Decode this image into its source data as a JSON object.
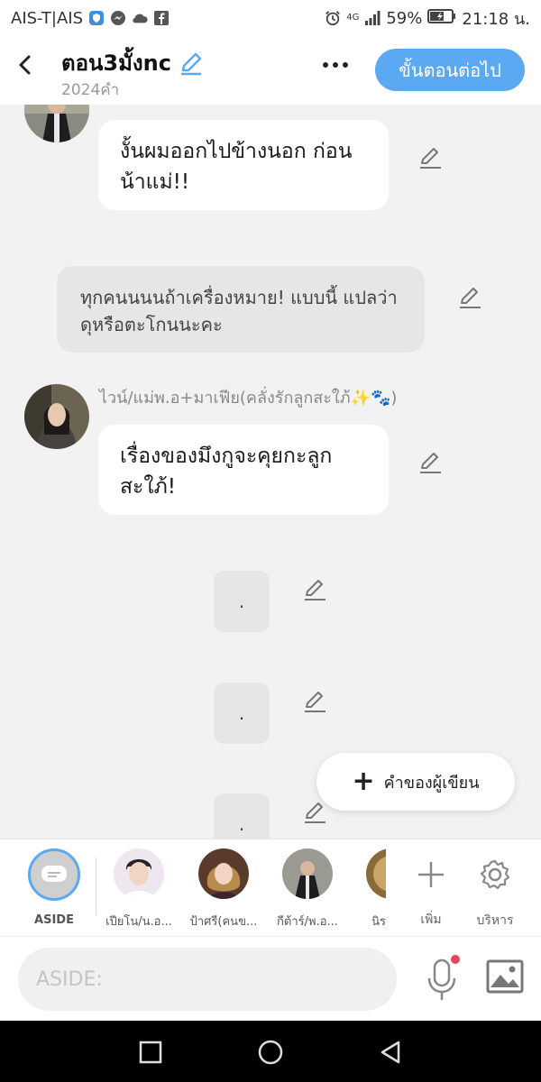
{
  "statusbar": {
    "carrier": "AIS-T|AIS",
    "network": "4G",
    "battery": "59%",
    "time": "21:18 น."
  },
  "header": {
    "title": "ตอน3มั้งnc",
    "subtitle": "2024คำ",
    "next_label": "ขั้นตอนต่อไป"
  },
  "messages": [
    {
      "type": "text",
      "text": "งั้นผมออกไปข้างนอก ก่อนน้าแม่!!"
    },
    {
      "type": "narration",
      "text": "ทุกคนนนนถ้าเครื่องหมาย! แบบนี้ แปลว่าดุหรือตะโกนนะคะ"
    },
    {
      "type": "text",
      "sender": "ไวน์/แม่พ.อ+มาเฟีย(คลั่งรักลูกสะใภ้✨🐾)",
      "text": "เรื่องของมึงกูจะคุยกะลูก สะใภ้!"
    },
    {
      "type": "dot",
      "text": "."
    },
    {
      "type": "dot",
      "text": "."
    },
    {
      "type": "dot",
      "text": "."
    }
  ],
  "writer_button": {
    "label": "คำของผู้เขียน"
  },
  "characters": {
    "aside_label": "ASIDE",
    "items": [
      {
        "label": "เปียโน/น.อ..."
      },
      {
        "label": "ป้าศรี(คนข..."
      },
      {
        "label": "กีต้าร์/พ.อ..."
      },
      {
        "label": "นิร"
      }
    ],
    "add_label": "เพิ่ม",
    "manage_label": "บริหาร"
  },
  "input": {
    "placeholder": "ASIDE:"
  },
  "colors": {
    "accent": "#5aa9f2",
    "background": "#f2f2f2",
    "notification": "#e8445a"
  }
}
